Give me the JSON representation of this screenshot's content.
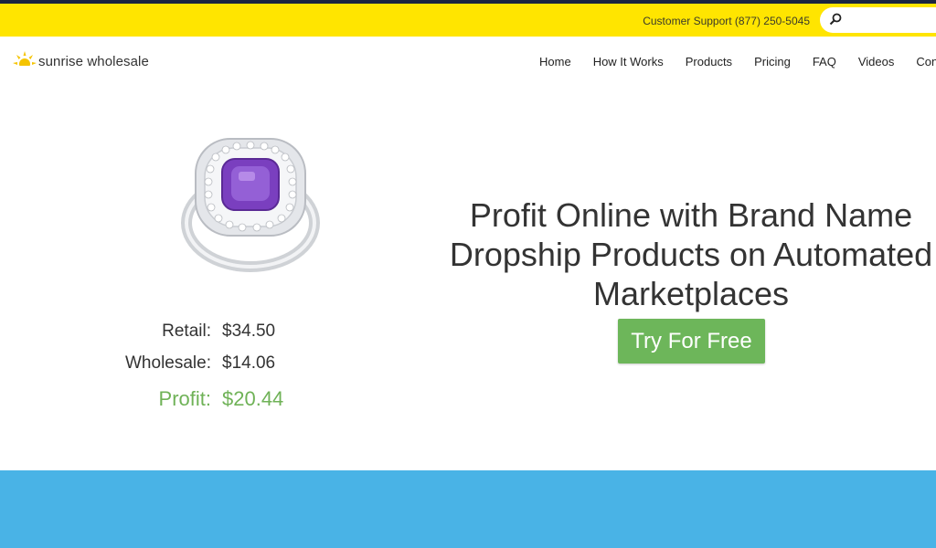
{
  "topbar": {
    "support_text": "Customer Support (877) 250-5045",
    "search_icon": "search-icon"
  },
  "header": {
    "logo_text": "sunrise wholesale",
    "nav": [
      {
        "label": "Home"
      },
      {
        "label": "How It Works"
      },
      {
        "label": "Products"
      },
      {
        "label": "Pricing"
      },
      {
        "label": "FAQ"
      },
      {
        "label": "Videos"
      },
      {
        "label": "Contact"
      }
    ]
  },
  "hero": {
    "retail_label": "Retail:",
    "retail_value": "$34.50",
    "wholesale_label": "Wholesale:",
    "wholesale_value": "$14.06",
    "profit_label": "Profit:",
    "profit_value": "$20.44",
    "headline": "Profit Online with Brand Name Dropship Products on Automated Marketplaces",
    "cta_label": "Try For Free"
  },
  "colors": {
    "topbar": "#ffe500",
    "accent_green": "#6db65a",
    "band_blue": "#49b3e6"
  }
}
